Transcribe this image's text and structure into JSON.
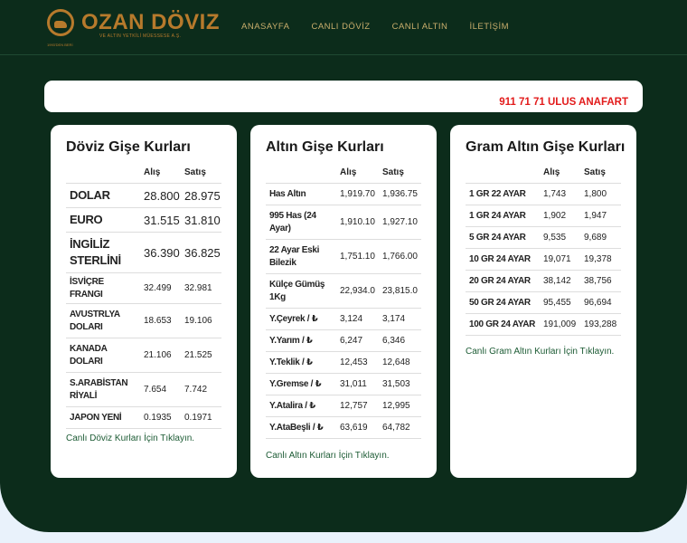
{
  "header": {
    "logo_name": "OZAN DÖVIZ",
    "logo_sub": "VE ALTIN YETKİLİ MÜESSESE A.Ş.",
    "logo_tiny": "1993'DEN BERİ",
    "nav": [
      "ANASAYFA",
      "CANLI DÖVİZ",
      "CANLI ALTIN",
      "İLETİŞİM"
    ]
  },
  "banner": {
    "text": "911 71 71  ULUS ANAFART"
  },
  "doviz": {
    "title": "Döviz Gişe Kurları",
    "col_buy": "Alış",
    "col_sell": "Satış",
    "rows": [
      {
        "name": "DOLAR",
        "buy": "28.800",
        "sell": "28.975"
      },
      {
        "name": "EURO",
        "buy": "31.515",
        "sell": "31.810"
      },
      {
        "name": "İNGİLİZ STERLİNİ",
        "buy": "36.390",
        "sell": "36.825"
      },
      {
        "name": "İSVİÇRE FRANGI",
        "buy": "32.499",
        "sell": "32.981"
      },
      {
        "name": "AVUSTRLYA DOLARI",
        "buy": "18.653",
        "sell": "19.106"
      },
      {
        "name": "KANADA DOLARI",
        "buy": "21.106",
        "sell": "21.525"
      },
      {
        "name": "S.ARABİSTAN RİYALİ",
        "buy": "7.654",
        "sell": "7.742"
      },
      {
        "name": "JAPON YENİ",
        "buy": "0.1935",
        "sell": "0.1971"
      }
    ],
    "link": "Canlı Döviz Kurları İçin Tıklayın."
  },
  "altin": {
    "title": "Altın Gişe Kurları",
    "col_buy": "Alış",
    "col_sell": "Satış",
    "rows": [
      {
        "name": "Has Altın",
        "buy": "1,919.70",
        "sell": "1,936.75"
      },
      {
        "name": "995 Has (24 Ayar)",
        "buy": "1,910.10",
        "sell": "1,927.10"
      },
      {
        "name": "22 Ayar Eski Bilezik",
        "buy": "1,751.10",
        "sell": "1,766.00"
      },
      {
        "name": "Külçe Gümüş 1Kg",
        "buy": "22,934.0",
        "sell": "23,815.0"
      },
      {
        "name": "Y.Çeyrek / ₺",
        "buy": "3,124",
        "sell": "3,174"
      },
      {
        "name": "Y.Yarım / ₺",
        "buy": "6,247",
        "sell": "6,346"
      },
      {
        "name": "Y.Teklik / ₺",
        "buy": "12,453",
        "sell": "12,648"
      },
      {
        "name": "Y.Gremse / ₺",
        "buy": "31,011",
        "sell": "31,503"
      },
      {
        "name": "Y.Atalira / ₺",
        "buy": "12,757",
        "sell": "12,995"
      },
      {
        "name": "Y.AtaBeşli / ₺",
        "buy": "63,619",
        "sell": "64,782"
      }
    ],
    "link": "Canlı Altın Kurları İçin Tıklayın."
  },
  "gram": {
    "title": "Gram Altın Gişe Kurları",
    "col_buy": "Alış",
    "col_sell": "Satış",
    "rows": [
      {
        "name": "1 GR 22 AYAR",
        "buy": "1,743",
        "sell": "1,800"
      },
      {
        "name": "1 GR 24 AYAR",
        "buy": "1,902",
        "sell": "1,947"
      },
      {
        "name": "5 GR 24 AYAR",
        "buy": "9,535",
        "sell": "9,689"
      },
      {
        "name": "10 GR 24 AYAR",
        "buy": "19,071",
        "sell": "19,378"
      },
      {
        "name": "20 GR 24 AYAR",
        "buy": "38,142",
        "sell": "38,756"
      },
      {
        "name": "50 GR 24 AYAR",
        "buy": "95,455",
        "sell": "96,694"
      },
      {
        "name": "100 GR 24 AYAR",
        "buy": "191,009",
        "sell": "193,288"
      }
    ],
    "link": "Canlı Gram Altın Kurları İçin Tıklayın."
  }
}
